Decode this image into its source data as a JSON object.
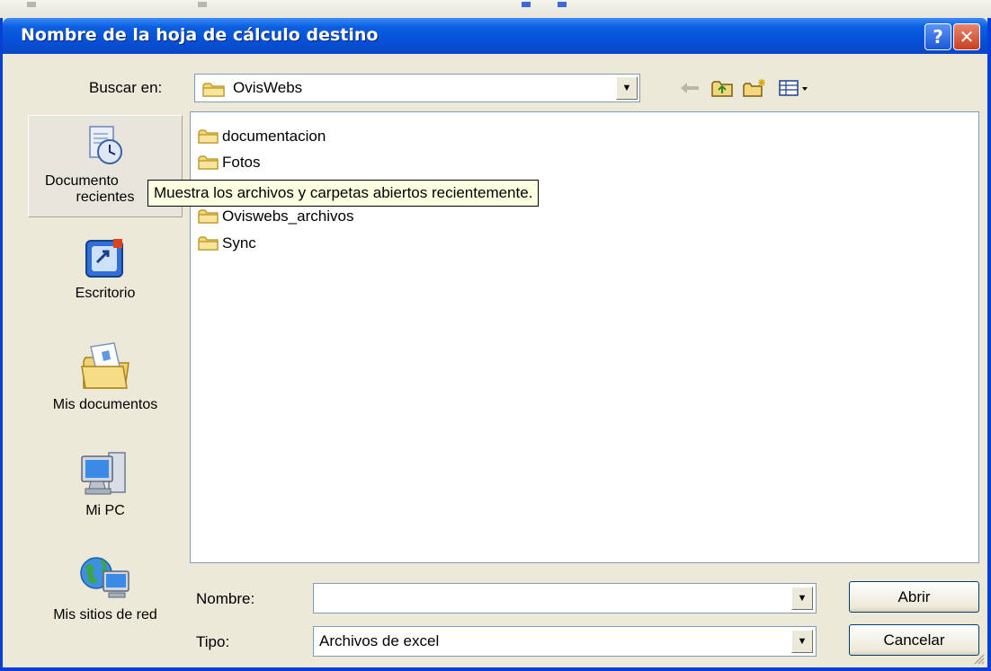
{
  "dialog": {
    "title": "Nombre de la hoja de cálculo destino",
    "help_glyph": "?",
    "close_glyph": "✕"
  },
  "lookin": {
    "label": "Buscar en:",
    "value": "OvisWebs"
  },
  "places": [
    {
      "label": "Documentos recientes",
      "icon": "recent-documents-icon"
    },
    {
      "label": "Escritorio",
      "icon": "desktop-icon"
    },
    {
      "label": "Mis documentos",
      "icon": "my-documents-icon"
    },
    {
      "label": "Mi PC",
      "icon": "my-computer-icon"
    },
    {
      "label": "Mis sitios de red",
      "icon": "network-places-icon"
    }
  ],
  "places_text": {
    "recent_line1": "Documento",
    "recent_line2": "recientes"
  },
  "files": [
    {
      "name": "documentacion",
      "icon": "folder-icon"
    },
    {
      "name": "Fotos",
      "icon": "folder-icon"
    },
    {
      "name": "Oviswebs_archivos",
      "icon": "folder-icon"
    },
    {
      "name": "Sync",
      "icon": "folder-icon"
    }
  ],
  "tooltip": "Muestra los archivos y carpetas abiertos recientemente.",
  "form": {
    "name_label": "Nombre:",
    "name_value": "",
    "type_label": "Tipo:",
    "type_value": "Archivos de excel"
  },
  "buttons": {
    "open": "Abrir",
    "cancel": "Cancelar"
  },
  "colors": {
    "title_bar": "#0652d8",
    "dialog_bg": "#ece9d8",
    "tooltip_bg": "#ffffe1"
  }
}
